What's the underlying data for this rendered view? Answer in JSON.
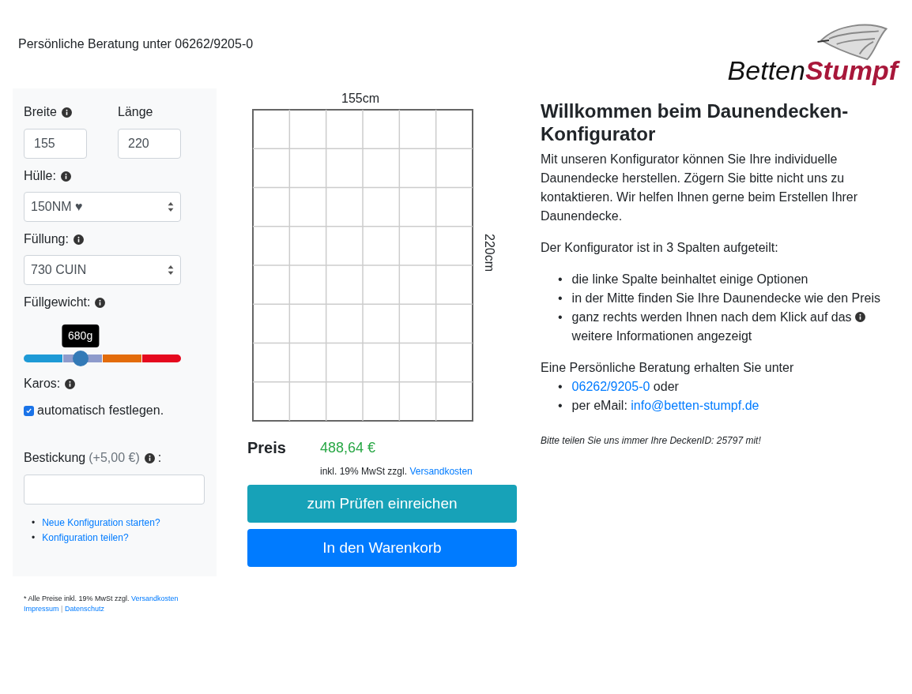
{
  "header": {
    "consultation": "Persönliche Beratung unter 06262/9205-0",
    "logo": {
      "part_1": "Betten",
      "part_2": "Stumpf"
    }
  },
  "options": {
    "width": {
      "label": "Breite",
      "value": "155"
    },
    "length": {
      "label": "Länge",
      "value": "220"
    },
    "cover": {
      "label": "Hülle:",
      "value": "150NM ♥"
    },
    "filling": {
      "label": "Füllung:",
      "value": "730 CUIN"
    },
    "fill_weight": {
      "label": "Füllgewicht:",
      "tooltip": "680g",
      "level": 0.36
    },
    "karos": {
      "label": "Karos:",
      "checkbox_label": "automatisch festlegen.",
      "checked": true
    },
    "embroidery": {
      "label": "Bestickung",
      "surcharge": "(+5,00 €)",
      "suffix": ":"
    },
    "links": [
      {
        "bullet": "•",
        "text": "Neue Konfiguration starten?"
      },
      {
        "bullet": "•",
        "text": "Konfiguration teilen?"
      }
    ]
  },
  "preview": {
    "width_label": "155cm",
    "length_label": "220cm"
  },
  "price": {
    "label": "Preis",
    "value": "488,64 €",
    "note": "inkl. 19% MwSt zzgl.",
    "note_link": "Versandkosten"
  },
  "buttons": [
    {
      "label": "zum Prüfen einreichen",
      "kind": "info"
    },
    {
      "label": "In den Warenkorb",
      "kind": "primary"
    }
  ],
  "welcome": {
    "title": "Willkommen beim Daunendecken-Konfigurator",
    "intro": "Mit unseren Konfigurator können Sie Ihre individuelle Daunendecke herstellen. Zögern Sie bitte nicht uns zu kontaktieren. Wir helfen Ihnen gerne beim Erstellen Ihrer Daunendecke.",
    "columns_intro": "Der Konfigurator ist in 3 Spalten aufgeteilt:",
    "columns": [
      {
        "bullet": "•",
        "text": "die linke Spalte beinhaltet einige Optionen"
      },
      {
        "bullet": "•",
        "text": "in der Mitte finden Sie Ihre Daunendecke wie den Preis"
      },
      {
        "bullet": "•",
        "text": "ganz rechts werden Ihnen nach dem Klick auf das",
        "after_icon": "weitere Informationen angezeigt"
      }
    ],
    "contact_intro": "Eine Persönliche Beratung erhalten Sie unter",
    "contact": [
      {
        "bullet": "•",
        "link": "06262/9205-0",
        "text": "oder"
      },
      {
        "bullet": "•",
        "text": "per eMail:",
        "link": "info@betten-stumpf.de"
      }
    ],
    "deck_id_note": "Bitte teilen Sie uns immer Ihre DeckenID: 25797 mit!"
  },
  "footer": {
    "note": "* Alle Preise inkl. 19% MwSt zzgl.",
    "note_link": "Versandkosten",
    "links": [
      "Impressum",
      "Datenschutz"
    ],
    "separator": "|"
  }
}
